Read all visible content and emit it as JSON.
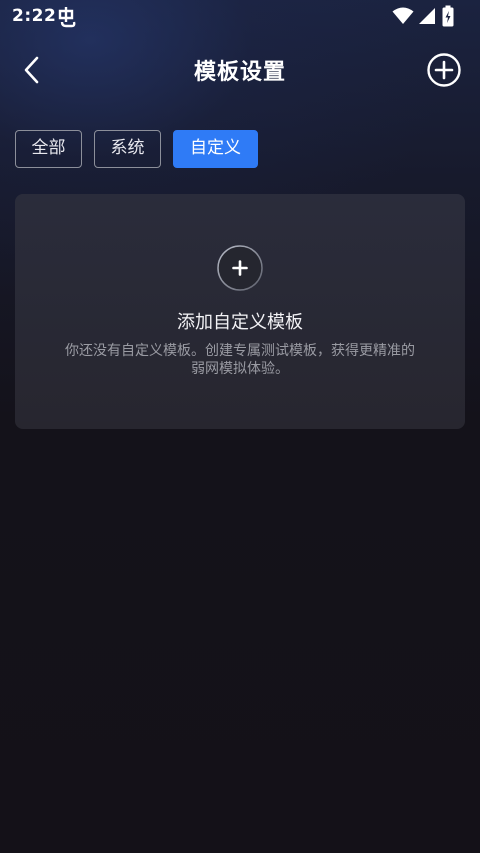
{
  "status_bar": {
    "time": "2:22"
  },
  "header": {
    "title": "模板设置"
  },
  "tabs": [
    {
      "label": "全部",
      "active": false
    },
    {
      "label": "系统",
      "active": false
    },
    {
      "label": "自定义",
      "active": true
    }
  ],
  "empty_state": {
    "title": "添加自定义模板",
    "description": "你还没有自定义模板。创建专属测试模板，获得更精准的弱网模拟体验。"
  },
  "icons": {
    "back": "chevron-left-icon",
    "add": "plus-circle-icon",
    "wifi": "wifi-icon",
    "signal": "cell-signal-icon",
    "battery": "battery-charging-icon"
  },
  "colors": {
    "accent": "#2f7bf6",
    "background": "#141118",
    "card": "#2a2c3b"
  }
}
